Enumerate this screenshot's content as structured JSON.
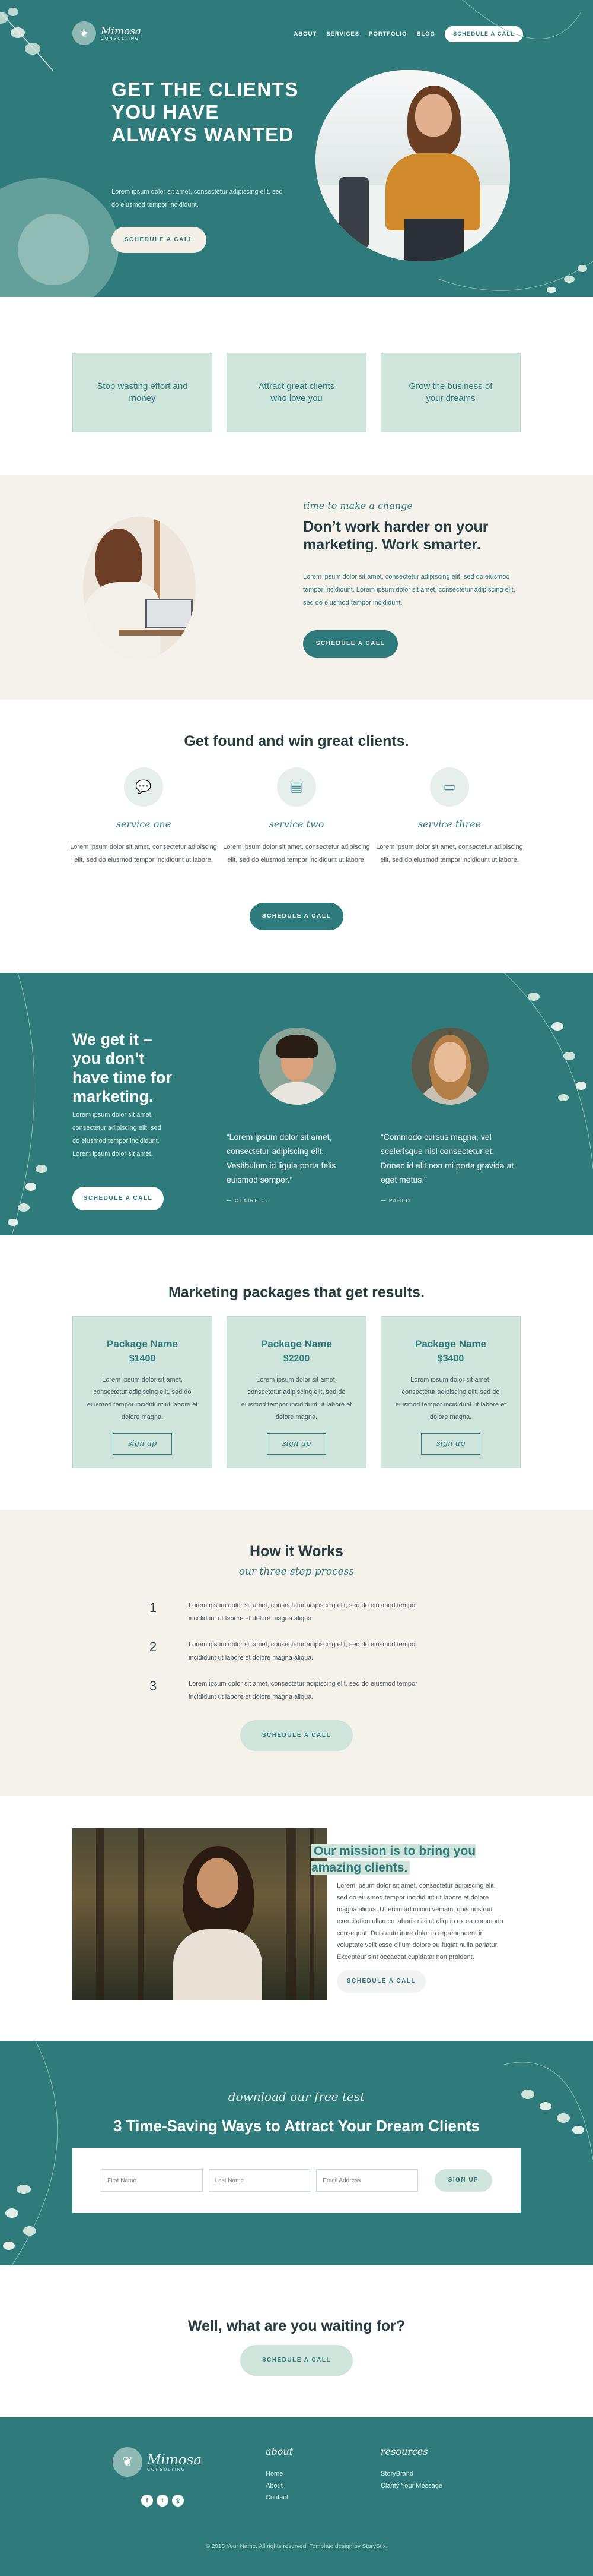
{
  "brand": {
    "name": "Mimosa",
    "tagline": "CONSULTING",
    "logo_icon": "leaf-logo-icon"
  },
  "nav": {
    "items": [
      "ABOUT",
      "SERVICES",
      "PORTFOLIO",
      "BLOG"
    ],
    "cta": "SCHEDULE A CALL"
  },
  "hero": {
    "title": "GET THE CLIENTS YOU HAVE ALWAYS WANTED",
    "text": "Lorem ipsum dolor sit amet, consectetur adipiscing elit, sed do eiusmod tempor incididunt.",
    "button": "SCHEDULE A CALL"
  },
  "benefits": [
    "Stop wasting effort and money",
    "Attract great clients who love you",
    "Grow the business of your dreams"
  ],
  "marketing": {
    "script": "time to make a change",
    "title": "Don’t work harder on your marketing. Work smarter.",
    "text": "Lorem ipsum dolor sit amet, consectetur adipiscing elit, sed do eiusmod tempor incididunt. Lorem ipsum dolor sit amet, consectetur adipiscing elit, sed do eiusmod tempor incididunt.",
    "button": "SCHEDULE A CALL"
  },
  "services": {
    "heading": "Get found and win great clients.",
    "items": [
      {
        "icon": "chat-bubbles-icon",
        "name": "service one",
        "desc": "Lorem ipsum dolor sit amet, consectetur adipiscing elit, sed do eiusmod tempor incididunt ut labore."
      },
      {
        "icon": "document-icon",
        "name": "service two",
        "desc": "Lorem ipsum dolor sit amet, consectetur adipiscing elit, sed do eiusmod tempor incididunt ut labore."
      },
      {
        "icon": "laptop-icon",
        "name": "service three",
        "desc": "Lorem ipsum dolor sit amet, consectetur adipiscing elit, sed do eiusmod tempor incididunt ut labore."
      }
    ],
    "button": "SCHEDULE A CALL"
  },
  "testimonials": {
    "title": "We get it – you don’t have time for marketing.",
    "text": "Lorem ipsum dolor sit amet, consectetur adipiscing elit, sed do eiusmod tempor incididunt. Lorem ipsum dolor sit amet.",
    "button": "SCHEDULE A CALL",
    "quotes": [
      {
        "text": "“Lorem ipsum dolor sit amet, consectetur adipiscing elit. Vestibulum id ligula porta felis euismod semper.”",
        "author": "— CLAIRE C."
      },
      {
        "text": "“Commodo cursus magna, vel scelerisque nisl consectetur et. Donec id elit non mi porta gravida at eget metus.”",
        "author": "— PABLO"
      }
    ]
  },
  "packages": {
    "heading": "Marketing packages that get results.",
    "items": [
      {
        "name": "Package Name",
        "price": "$1400",
        "desc": "Lorem ipsum dolor sit amet, consectetur adipiscing elit, sed do eiusmod tempor incididunt ut labore et dolore magna.",
        "cta": "sign up"
      },
      {
        "name": "Package Name",
        "price": "$2200",
        "desc": "Lorem ipsum dolor sit amet, consectetur adipiscing elit, sed do eiusmod tempor incididunt ut labore et dolore magna.",
        "cta": "sign up"
      },
      {
        "name": "Package Name",
        "price": "$3400",
        "desc": "Lorem ipsum dolor sit amet, consectetur adipiscing elit, sed do eiusmod tempor incididunt ut labore et dolore magna.",
        "cta": "sign up"
      }
    ]
  },
  "how": {
    "title": "How it Works",
    "subtitle": "our three step process",
    "steps": [
      {
        "num": "1",
        "text": "Lorem ipsum dolor sit amet, consectetur adipiscing elit, sed do eiusmod tempor incididunt ut labore et dolore magna aliqua."
      },
      {
        "num": "2",
        "text": "Lorem ipsum dolor sit amet, consectetur adipiscing elit, sed do eiusmod tempor incididunt ut labore et dolore magna aliqua."
      },
      {
        "num": "3",
        "text": "Lorem ipsum dolor sit amet, consectetur adipiscing elit, sed do eiusmod tempor incididunt ut labore et dolore magna aliqua."
      }
    ],
    "button": "SCHEDULE A CALL"
  },
  "mission": {
    "title": "Our mission is to bring you amazing clients.",
    "text": "Lorem ipsum dolor sit amet, consectetur adipiscing elit, sed do eiusmod tempor incididunt ut labore et dolore magna aliqua. Ut enim ad minim veniam, quis nostrud exercitation ullamco laboris nisi ut aliquip ex ea commodo consequat. Duis aute irure dolor in reprehenderit in voluptate velit esse cillum dolore eu fugiat nulla pariatur. Excepteur sint occaecat cupidatat non proident.",
    "button": "SCHEDULE A CALL"
  },
  "freebie": {
    "script": "download our free test",
    "title": "3 Time-Saving Ways to Attract Your Dream Clients",
    "first_placeholder": "First Name",
    "last_placeholder": "Last Name",
    "email_placeholder": "Email Address",
    "button": "SIGN UP"
  },
  "waiting": {
    "title": "Well, what are you waiting for?",
    "button": "SCHEDULE A CALL"
  },
  "footer": {
    "about_heading": "about",
    "about_links": [
      "Home",
      "About",
      "Contact"
    ],
    "resources_heading": "resources",
    "resources_links": [
      "StoryBrand",
      "Clarify Your Message"
    ],
    "social": [
      "f",
      "t",
      "◎"
    ],
    "copyright": "© 2018 Your Name. All rights reserved. Template design by StoryStix."
  },
  "colors": {
    "teal": "#2f7b7c",
    "mint": "#cfe5dc",
    "cream": "#f5f2ec"
  }
}
